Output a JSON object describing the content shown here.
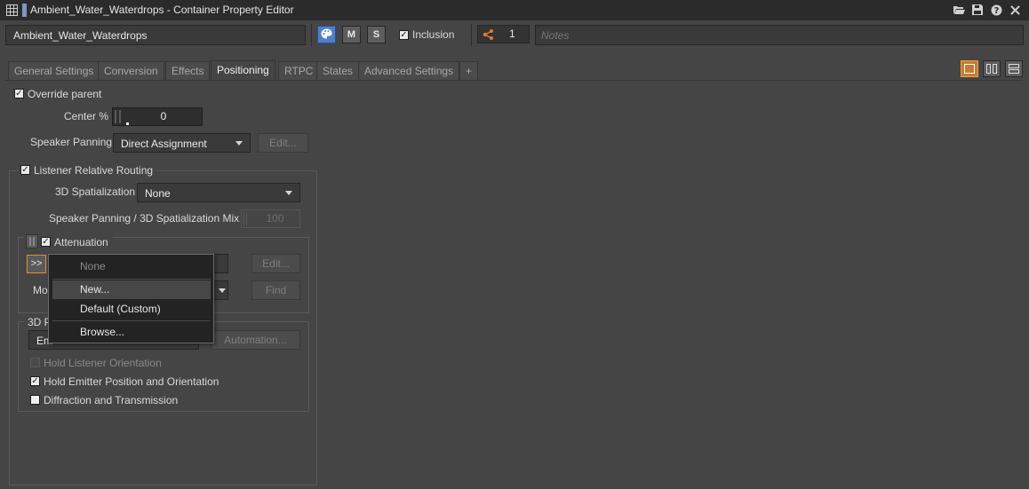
{
  "window": {
    "title": "Ambient_Water_Waterdrops - Container Property Editor",
    "icons": [
      "grid-icon",
      "folder-open-icon",
      "save-icon",
      "help-icon",
      "close-icon"
    ]
  },
  "header": {
    "name": "Ambient_Water_Waterdrops",
    "color_btn_icon": "palette-icon",
    "mute_label": "M",
    "solo_label": "S",
    "inclusion_label": "Inclusion",
    "inclusion_checked": true,
    "share_count": "1",
    "notes_placeholder": "Notes"
  },
  "tabs": [
    {
      "label": "General Settings"
    },
    {
      "label": "Conversion"
    },
    {
      "label": "Effects"
    },
    {
      "label": "Positioning",
      "active": true
    },
    {
      "label": "RTPC"
    },
    {
      "label": "States"
    },
    {
      "label": "Advanced Settings"
    },
    {
      "label": "+"
    }
  ],
  "positioning": {
    "override_parent": "Override parent",
    "center_label": "Center %",
    "center_value": "0",
    "speaker_panning_label": "Speaker Panning",
    "speaker_panning_value": "Direct Assignment",
    "edit_label": "Edit...",
    "listener_relative_routing": "Listener Relative Routing",
    "spatialization_label": "3D Spatialization",
    "spatialization_value": "None",
    "mix_label": "Speaker Panning / 3D Spatialization Mix",
    "mix_value": "100",
    "attenuation_label": "Attenuation",
    "expand_label": ">>",
    "attenuation_edit": "Edit...",
    "mode_label_partial": "Mo",
    "find_label": "Find",
    "position_group_partial": "3D P",
    "emitter_partial": "Em",
    "automation_label": "Automation...",
    "hold_listener": "Hold Listener Orientation",
    "hold_emitter": "Hold Emitter Position and Orientation",
    "diffraction": "Diffraction and Transmission"
  },
  "menu": {
    "items": [
      {
        "label": "None",
        "disabled": true
      },
      {
        "label": "New...",
        "highlighted": true
      },
      {
        "label": "Default (Custom)"
      },
      {
        "label": "Browse..."
      }
    ]
  },
  "colors": {
    "accent_blue": "#4e7fc9",
    "accent_orange": "#c87b2e",
    "background": "#454545"
  }
}
